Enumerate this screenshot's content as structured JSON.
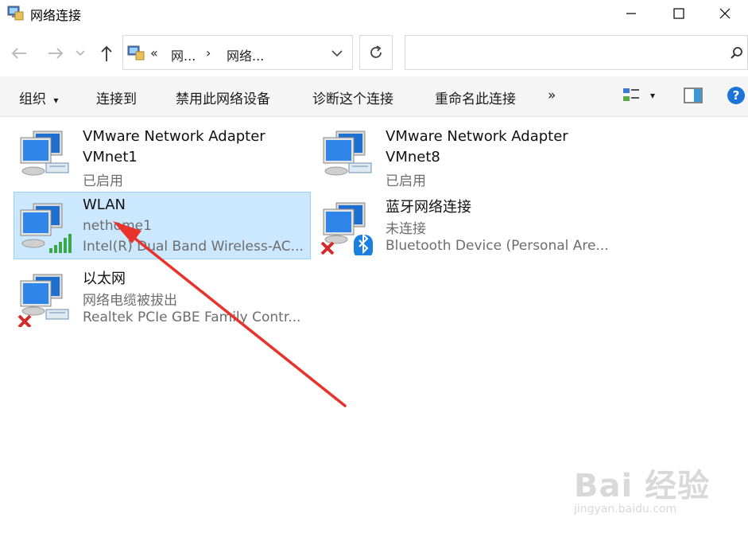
{
  "window": {
    "title": "网络连接",
    "icon": "network-folder-icon"
  },
  "address": {
    "back_icon": "arrow-left-icon",
    "forward_icon": "arrow-right-icon",
    "recent_icon": "chevron-down-icon",
    "up_icon": "arrow-up-icon",
    "overflow": "«",
    "crumb_1": "网...",
    "crumb_sep": "›",
    "crumb_2": "网络...",
    "dropdown_icon": "chevron-down-icon",
    "refresh_icon": "refresh-icon",
    "search_placeholder": "",
    "search_icon": "search-icon"
  },
  "toolbar": {
    "organize": "组织",
    "organize_arrow": "▾",
    "connect_to": "连接到",
    "disable_device": "禁用此网络设备",
    "diagnose": "诊断这个连接",
    "rename": "重命名此连接",
    "more": "»",
    "view_arrow": "▾"
  },
  "connections": [
    {
      "name": "VMware Network Adapter",
      "name2": "VMnet1",
      "status": "已启用",
      "device": "",
      "icon": "ethernet-adapter-icon",
      "selected": false
    },
    {
      "name": "VMware Network Adapter",
      "name2": "VMnet8",
      "status": "已启用",
      "device": "",
      "icon": "ethernet-adapter-icon",
      "selected": false
    },
    {
      "name": "WLAN",
      "name2": "",
      "status": "nethome1",
      "device": "Intel(R) Dual Band Wireless-AC...",
      "icon": "wifi-adapter-icon",
      "selected": true
    },
    {
      "name": "蓝牙网络连接",
      "name2": "",
      "status": "未连接",
      "device": "Bluetooth Device (Personal Are...",
      "icon": "bluetooth-adapter-icon",
      "selected": false
    },
    {
      "name": "以太网",
      "name2": "",
      "status": "网络电缆被拔出",
      "device": "Realtek PCIe GBE Family Contr...",
      "icon": "ethernet-disconnected-icon",
      "selected": false
    }
  ],
  "watermark": {
    "logo": "Bai 经验",
    "url": "jingyan.baidu.com"
  },
  "colors": {
    "selection_bg": "#cce8ff",
    "selection_border": "#99d1ff",
    "arrow": "#e8322b",
    "monitor_blue": "#1e6fd0"
  }
}
